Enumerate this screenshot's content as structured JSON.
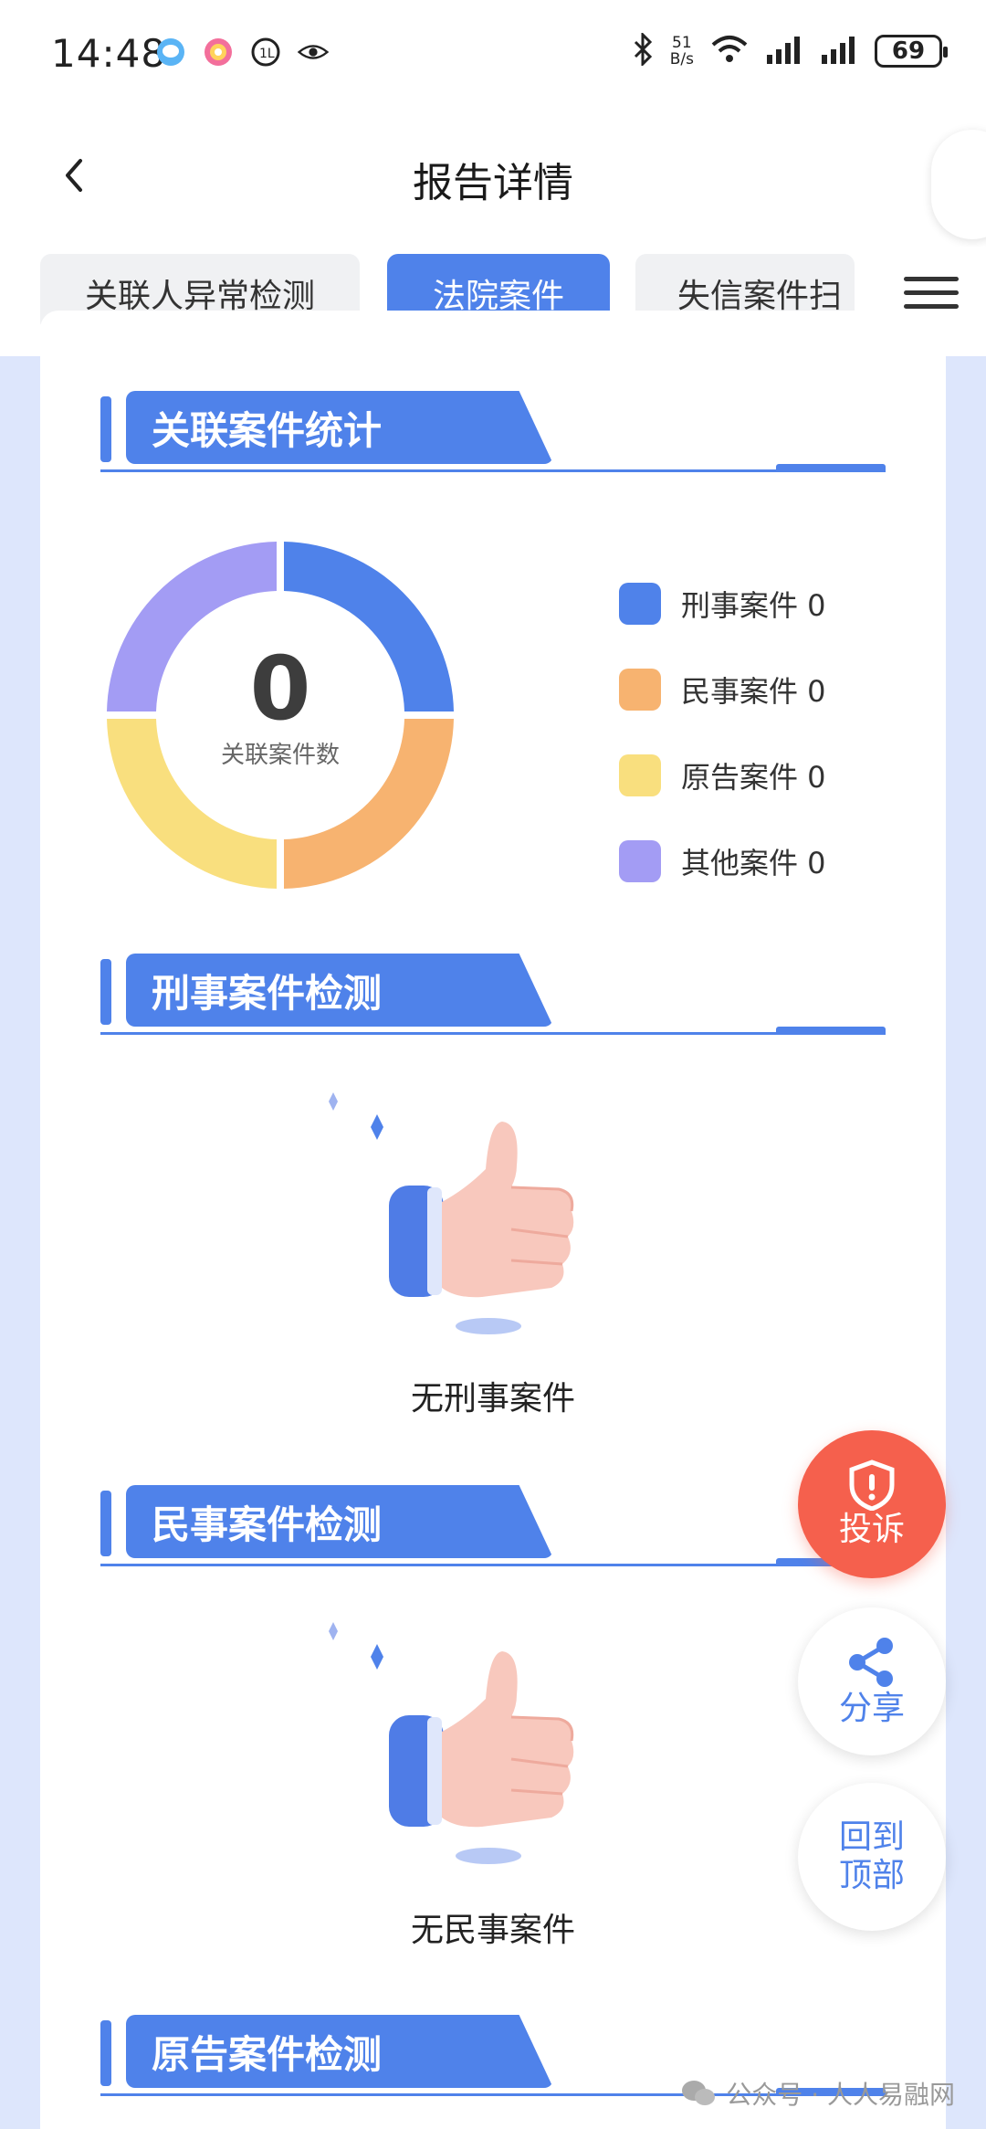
{
  "status_bar": {
    "time": "14:48",
    "net_speed_value": "51",
    "net_speed_unit": "B/s",
    "battery": "69"
  },
  "header": {
    "title": "报告详情"
  },
  "tabs": [
    {
      "label": "关联人异常检测",
      "active": false
    },
    {
      "label": "法院案件",
      "active": true
    },
    {
      "label": "失信案件扫",
      "active": false
    }
  ],
  "summary_section": {
    "title": "关联案件统计",
    "total_count": "0",
    "total_label": "关联案件数",
    "legend": [
      {
        "label": "刑事案件 0",
        "color": "#4f82ea",
        "value": 0
      },
      {
        "label": "民事案件 0",
        "color": "#f7b370",
        "value": 0
      },
      {
        "label": "原告案件 0",
        "color": "#f9df7e",
        "value": 0
      },
      {
        "label": "其他案件 0",
        "color": "#a39cf4",
        "value": 0
      }
    ]
  },
  "criminal_section": {
    "title": "刑事案件检测",
    "empty_text": "无刑事案件"
  },
  "civil_section": {
    "title": "民事案件检测",
    "empty_text": "无民事案件"
  },
  "plaintiff_section": {
    "title": "原告案件检测"
  },
  "floating_buttons": {
    "complaint": "投诉",
    "share": "分享",
    "back_top_line1": "回到",
    "back_top_line2": "顶部"
  },
  "watermark": "公众号 · 人人易融网"
}
